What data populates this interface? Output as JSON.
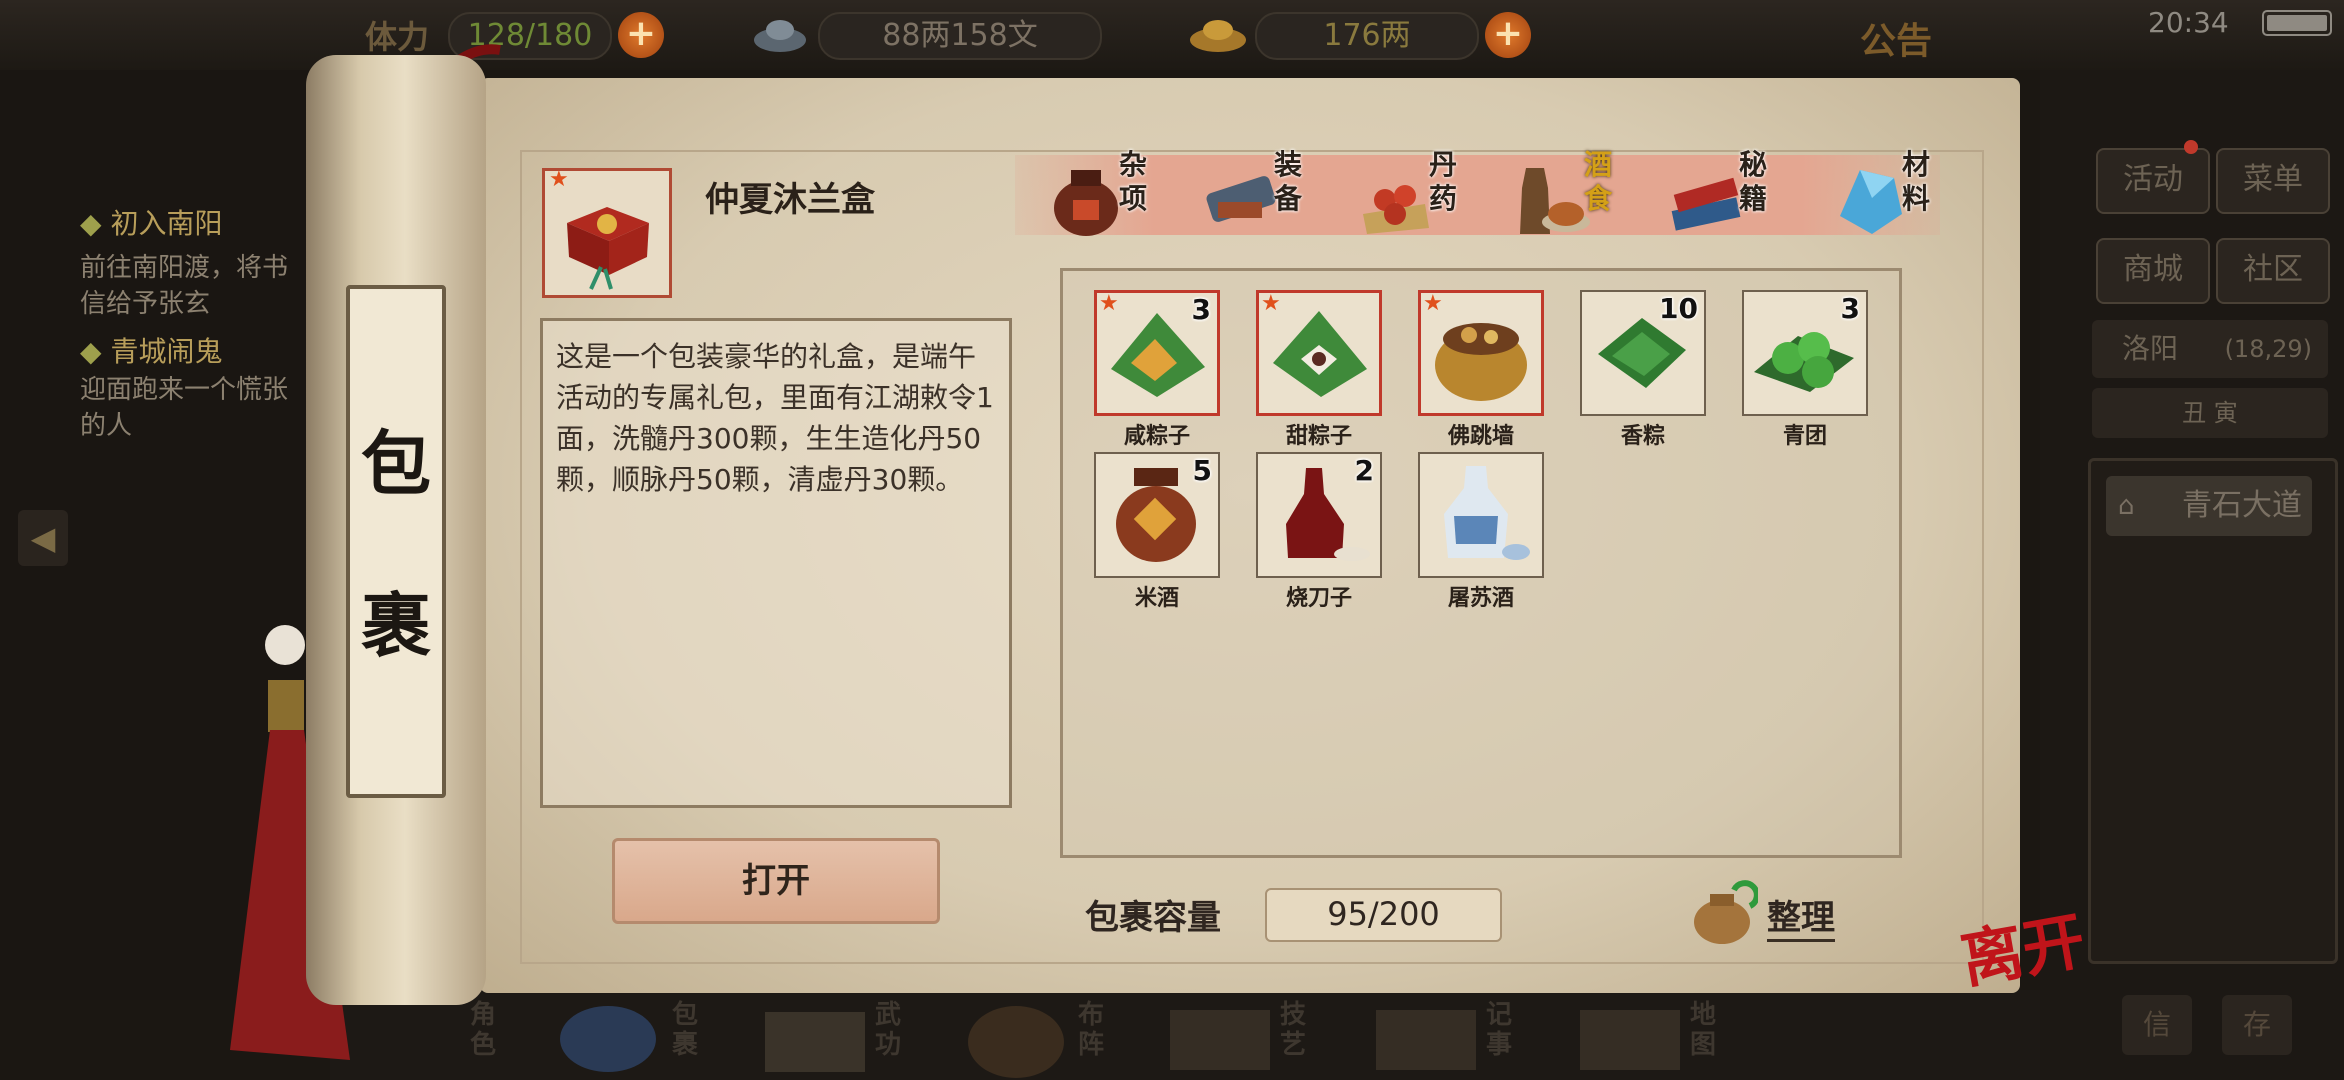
{
  "status": {
    "stamina_label": "体力",
    "stamina": "128/180",
    "money": "88两158文",
    "gold": "176两",
    "notice": "公告",
    "time": "20:34"
  },
  "quests": [
    {
      "title": "初入南阳",
      "text": "前往南阳渡，将书信给予张玄"
    },
    {
      "title": "青城闹鬼",
      "text": "迎面跑来一个慌张的人"
    }
  ],
  "right_panel": {
    "activity": "活动",
    "menu": "菜单",
    "shop": "商城",
    "community": "社区",
    "location": "洛阳",
    "coords": "(18,29)",
    "time_period": "丑  寅",
    "road": "青石大道",
    "btn_letter": "信",
    "btn_store": "存"
  },
  "scroll_title": [
    "包",
    "裹"
  ],
  "selected_item": {
    "name": "仲夏沐兰盒",
    "description": "这是一个包装豪华的礼盒，是端午活动的专属礼包，里面有江湖敕令1面，洗髓丹300颗，生生造化丹50颗，顺脉丹50颗，清虚丹30颗。",
    "open_label": "打开"
  },
  "tabs": [
    {
      "label": "杂项",
      "icon": "jar-icon",
      "active": false
    },
    {
      "label": "装备",
      "icon": "scroll-equip-icon",
      "active": false
    },
    {
      "label": "丹药",
      "icon": "pills-icon",
      "active": false
    },
    {
      "label": "酒食",
      "icon": "wine-food-icon",
      "active": true
    },
    {
      "label": "秘籍",
      "icon": "books-icon",
      "active": false
    },
    {
      "label": "材料",
      "icon": "crystal-icon",
      "active": false
    }
  ],
  "items": [
    {
      "name": "咸粽子",
      "count": "3",
      "rare": true,
      "icon": "zongzi-icon"
    },
    {
      "name": "甜粽子",
      "count": "",
      "rare": true,
      "icon": "sweet-zongzi-icon"
    },
    {
      "name": "佛跳墙",
      "count": "",
      "rare": true,
      "icon": "pot-dish-icon"
    },
    {
      "name": "香粽",
      "count": "10",
      "rare": false,
      "icon": "green-zongzi-icon"
    },
    {
      "name": "青团",
      "count": "3",
      "rare": false,
      "icon": "qingtuan-icon"
    },
    {
      "name": "米酒",
      "count": "5",
      "rare": false,
      "icon": "rice-wine-jar-icon"
    },
    {
      "name": "烧刀子",
      "count": "2",
      "rare": false,
      "icon": "red-wine-bottle-icon"
    },
    {
      "name": "屠苏酒",
      "count": "",
      "rare": false,
      "icon": "porcelain-wine-icon"
    }
  ],
  "capacity": {
    "label": "包裹容量",
    "value": "95/200"
  },
  "sort_label": "整理",
  "leave_label": "离开",
  "bottom_nav": [
    "角色",
    "包裹",
    "武功",
    "布阵",
    "技艺",
    "记事",
    "地图"
  ],
  "colors": {
    "accent_red": "#c0392b",
    "active_tab": "#d4a017",
    "paper": "#ddd0b6"
  }
}
